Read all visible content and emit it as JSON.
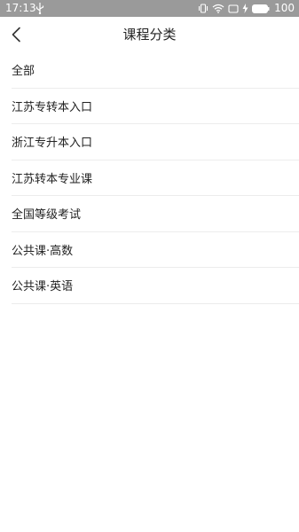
{
  "status_bar": {
    "time": "17:13",
    "battery_level": "100",
    "icons": [
      "usb-icon",
      "vibrate-icon",
      "wifi-icon",
      "screen-icon",
      "charging-icon",
      "battery-icon"
    ]
  },
  "header": {
    "title": "课程分类",
    "back_icon": "chevron-left-icon"
  },
  "categories": [
    {
      "label": "全部"
    },
    {
      "label": "江苏专转本入口"
    },
    {
      "label": "浙江专升本入口"
    },
    {
      "label": "江苏转本专业课"
    },
    {
      "label": "全国等级考试"
    },
    {
      "label": "公共课·高数"
    },
    {
      "label": "公共课·英语"
    }
  ],
  "colors": {
    "status_bar_bg": "#9a9a9a",
    "divider": "#ececec",
    "text": "#222222"
  }
}
